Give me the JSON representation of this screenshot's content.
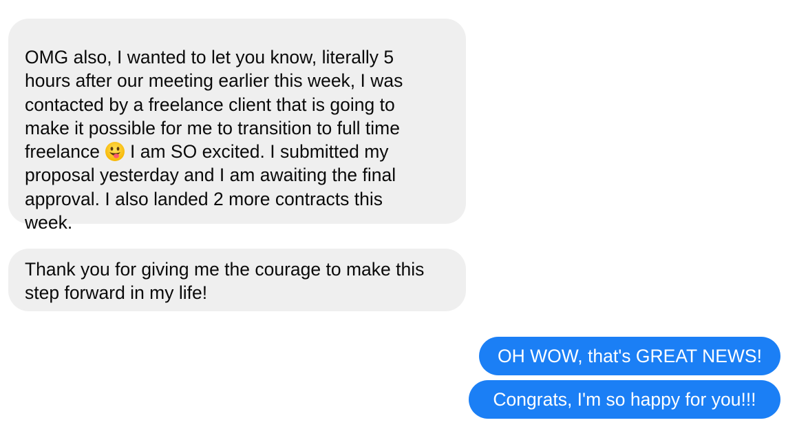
{
  "messages": {
    "incoming_1": {
      "lines_before_emoji": [
        "OMG also, I wanted to let you know, literally 5",
        "hours after our meeting earlier this week, I was",
        "contacted by a freelance client that is going to",
        "make it possible for me to transition to full time"
      ],
      "emoji_line_start": "freelance",
      "emoji": "grinning-face-with-tongue-icon",
      "emoji_line_end": "I am SO excited. I submitted my",
      "lines_after_emoji": [
        "proposal yesterday and I am awaiting the final",
        "approval. I also landed 2 more contracts this",
        "week."
      ]
    },
    "incoming_2": {
      "lines": [
        "Thank you for giving me the courage to make this",
        "step forward in my life!"
      ]
    },
    "outgoing_1": "OH WOW, that's GREAT NEWS!",
    "outgoing_2": "Congrats, I'm so happy for you!!!"
  },
  "colors": {
    "incoming_bubble": "#efefef",
    "incoming_text": "#0a0a0a",
    "outgoing_bubble": "#1b7ff5",
    "outgoing_text": "#ffffff"
  }
}
